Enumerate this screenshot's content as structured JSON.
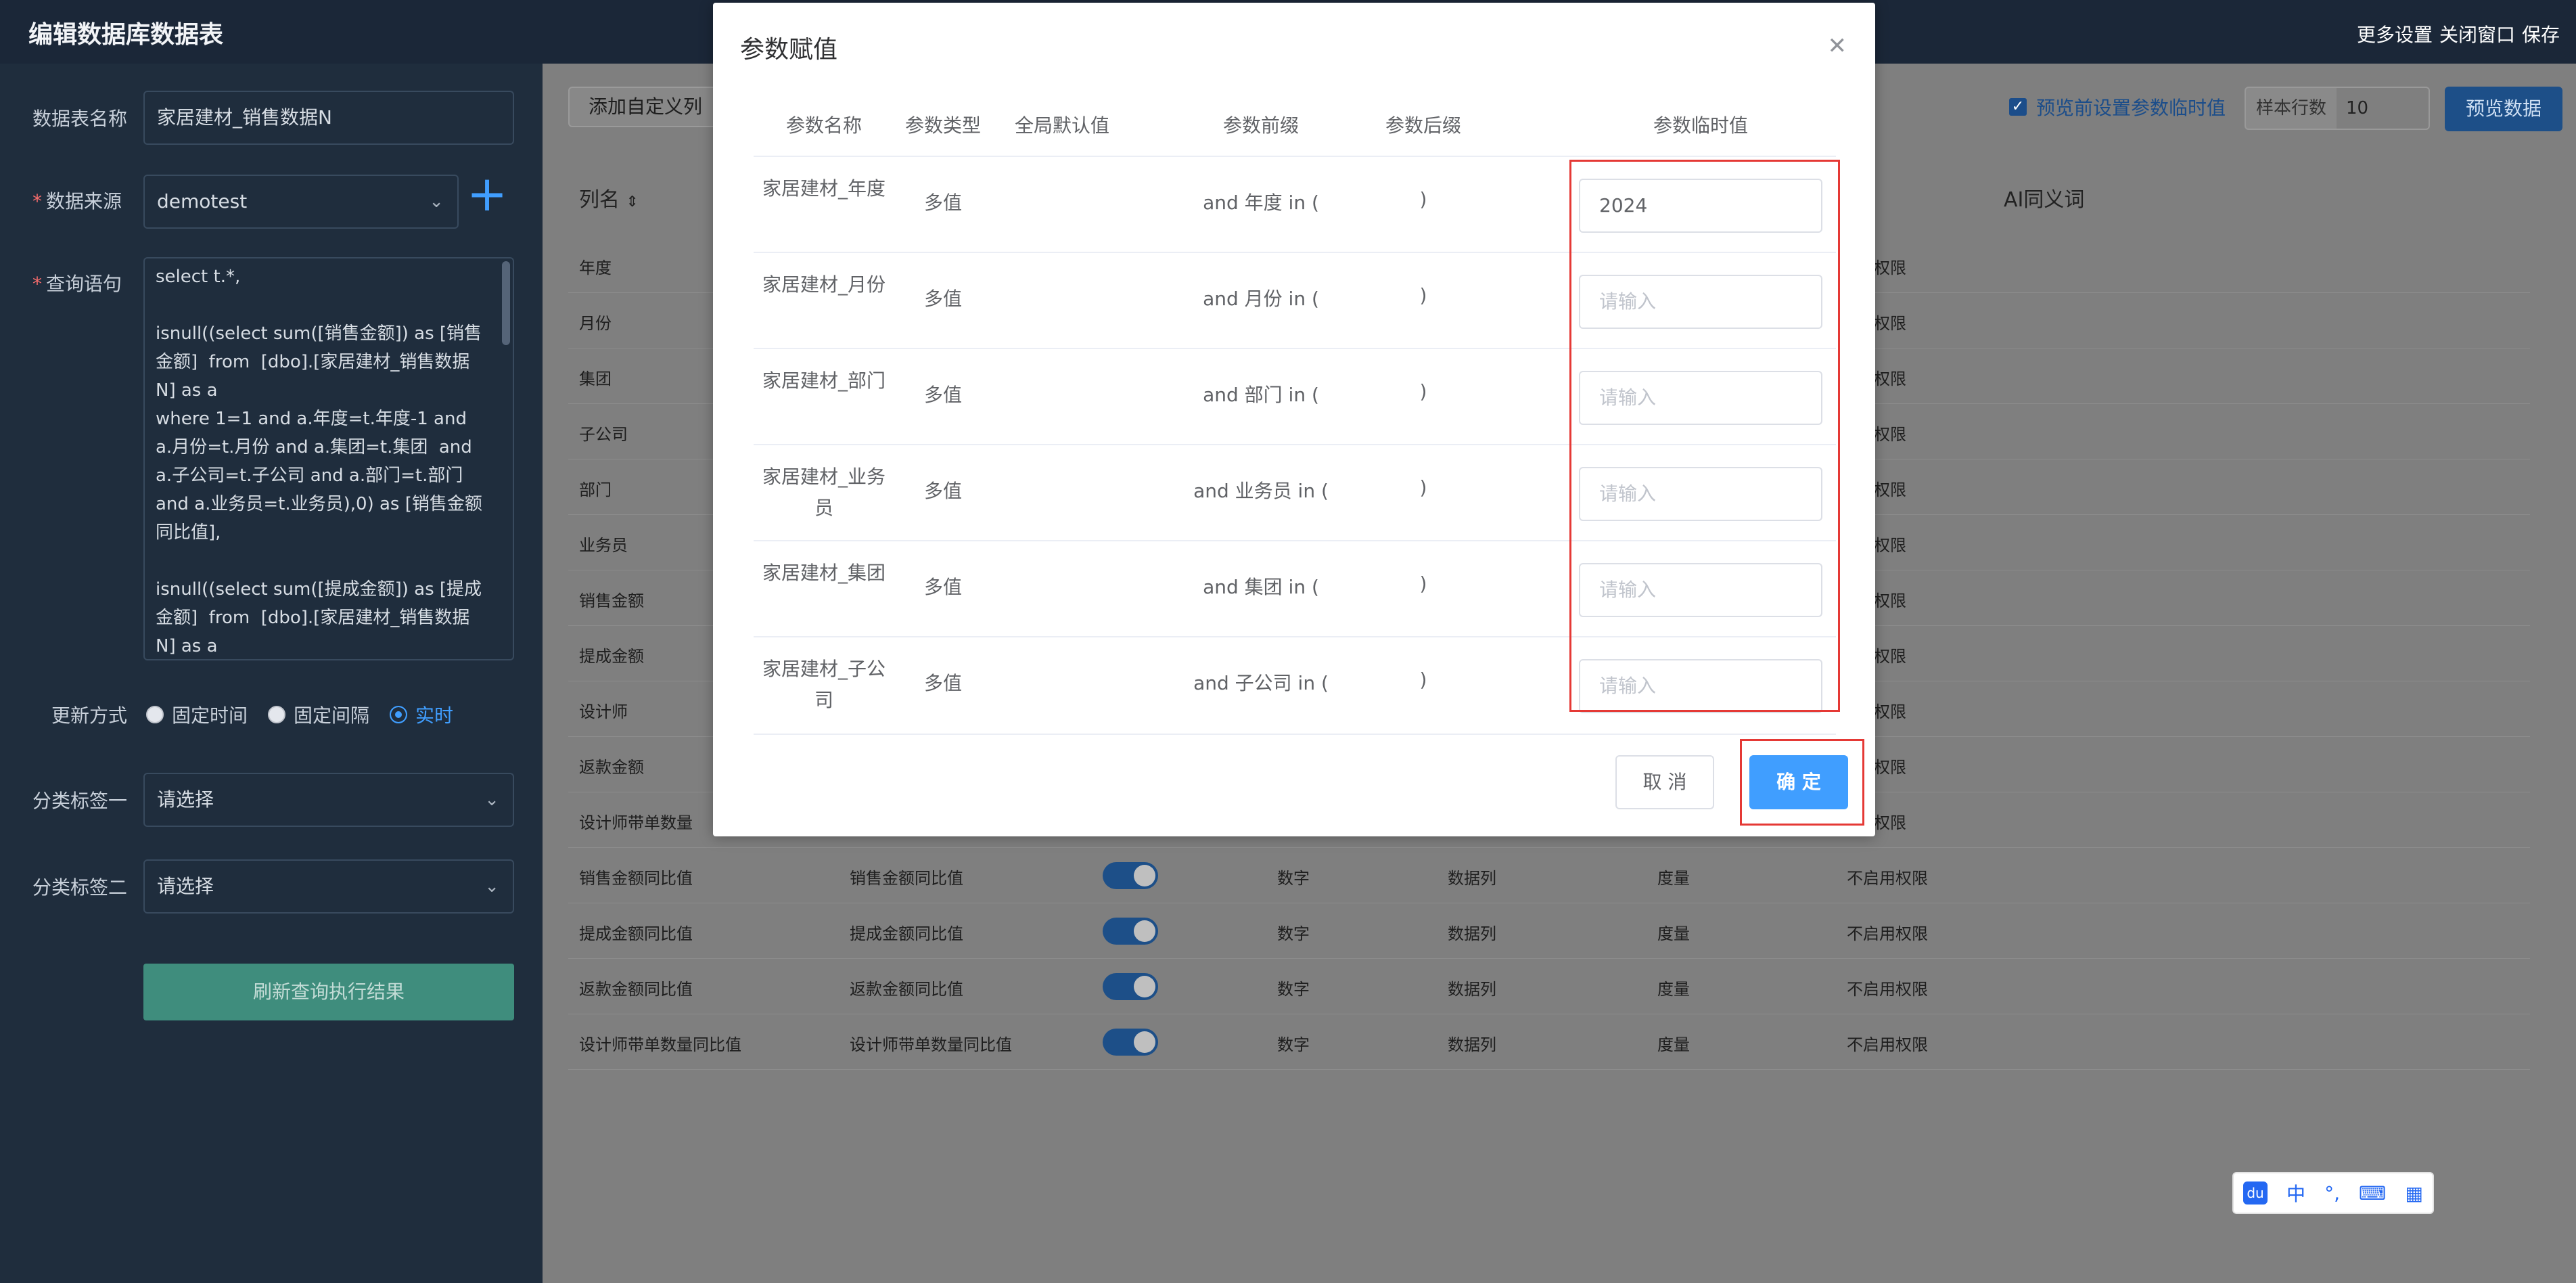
{
  "app_title": "编辑数据库数据表",
  "top_actions": [
    "更多设置",
    "关闭窗口",
    "保存"
  ],
  "form": {
    "table_name_label": "数据表名称",
    "table_name_value": "家居建材_销售数据N",
    "source_label": "数据来源",
    "source_value": "demotest",
    "query_label": "查询语句",
    "query_text": "select t.*,\n\nisnull((select sum([销售金额]) as [销售金额]  from  [dbo].[家居建材_销售数据N] as a\nwhere 1=1 and a.年度=t.年度-1 and a.月份=t.月份 and a.集团=t.集团  and a.子公司=t.子公司 and a.部门=t.部门 and a.业务员=t.业务员),0) as [销售金额同比值],\n\nisnull((select sum([提成金额]) as [提成金额]  from  [dbo].[家居建材_销售数据N] as a",
    "update_label": "更新方式",
    "update_options": [
      "固定时间",
      "固定间隔",
      "实时"
    ],
    "update_selected": "实时",
    "tag1_label": "分类标签一",
    "tag1_value": "请选择",
    "tag2_label": "分类标签二",
    "tag2_value": "请选择",
    "refresh_button": "刷新查询执行结果"
  },
  "toolbar": {
    "add_column": "添加自定义列",
    "preview_checkbox": "预览前设置参数临时值",
    "rows_label": "样本行数",
    "rows_value": "10",
    "preview_button": "预览数据"
  },
  "grid": {
    "headers": {
      "column_name": "列名",
      "ai_synonym": "AI同义词"
    },
    "hidden_rows_tail": [
      "年度",
      "月份",
      "集团",
      "子公司",
      "部门",
      "业务员",
      "销售金额",
      "提成金额",
      "设计师",
      "返款金额",
      "设计师带单数量"
    ],
    "partial_permission": "权限",
    "rows": [
      {
        "name": "销售金额同比值",
        "alias": "销售金额同比值",
        "type": "数字",
        "kind": "数据列",
        "role": "度量",
        "perm": "不启用权限"
      },
      {
        "name": "提成金额同比值",
        "alias": "提成金额同比值",
        "type": "数字",
        "kind": "数据列",
        "role": "度量",
        "perm": "不启用权限"
      },
      {
        "name": "返款金额同比值",
        "alias": "返款金额同比值",
        "type": "数字",
        "kind": "数据列",
        "role": "度量",
        "perm": "不启用权限"
      },
      {
        "name": "设计师带单数量同比值",
        "alias": "设计师带单数量同比值",
        "type": "数字",
        "kind": "数据列",
        "role": "度量",
        "perm": "不启用权限"
      }
    ]
  },
  "dialog": {
    "title": "参数赋值",
    "headers": [
      "参数名称",
      "参数类型",
      "全局默认值",
      "参数前缀",
      "参数后缀",
      "参数临时值"
    ],
    "rows": [
      {
        "name": "家居建材_年度",
        "type": "多值",
        "prefix": "and 年度 in (",
        "suffix": ")",
        "value": "2024",
        "placeholder": ""
      },
      {
        "name": "家居建材_月份",
        "type": "多值",
        "prefix": "and 月份 in (",
        "suffix": ")",
        "value": "",
        "placeholder": "请输入"
      },
      {
        "name": "家居建材_部门",
        "type": "多值",
        "prefix": "and 部门 in   (",
        "suffix": ")",
        "value": "",
        "placeholder": "请输入"
      },
      {
        "name": "家居建材_业务员",
        "type": "多值",
        "prefix": "and 业务员 in (",
        "suffix": ")",
        "value": "",
        "placeholder": "请输入"
      },
      {
        "name": "家居建材_集团",
        "type": "多值",
        "prefix": "and 集团 in (",
        "suffix": ")",
        "value": "",
        "placeholder": "请输入"
      },
      {
        "name": "家居建材_子公司",
        "type": "多值",
        "prefix": "and 子公司 in (",
        "suffix": ")",
        "value": "",
        "placeholder": "请输入"
      }
    ],
    "cancel": "取 消",
    "confirm": "确 定"
  },
  "ime": {
    "logo": "du",
    "lang": "中",
    "punct": "°,",
    "icons": [
      "keyboard-icon",
      "grid-icon"
    ]
  }
}
